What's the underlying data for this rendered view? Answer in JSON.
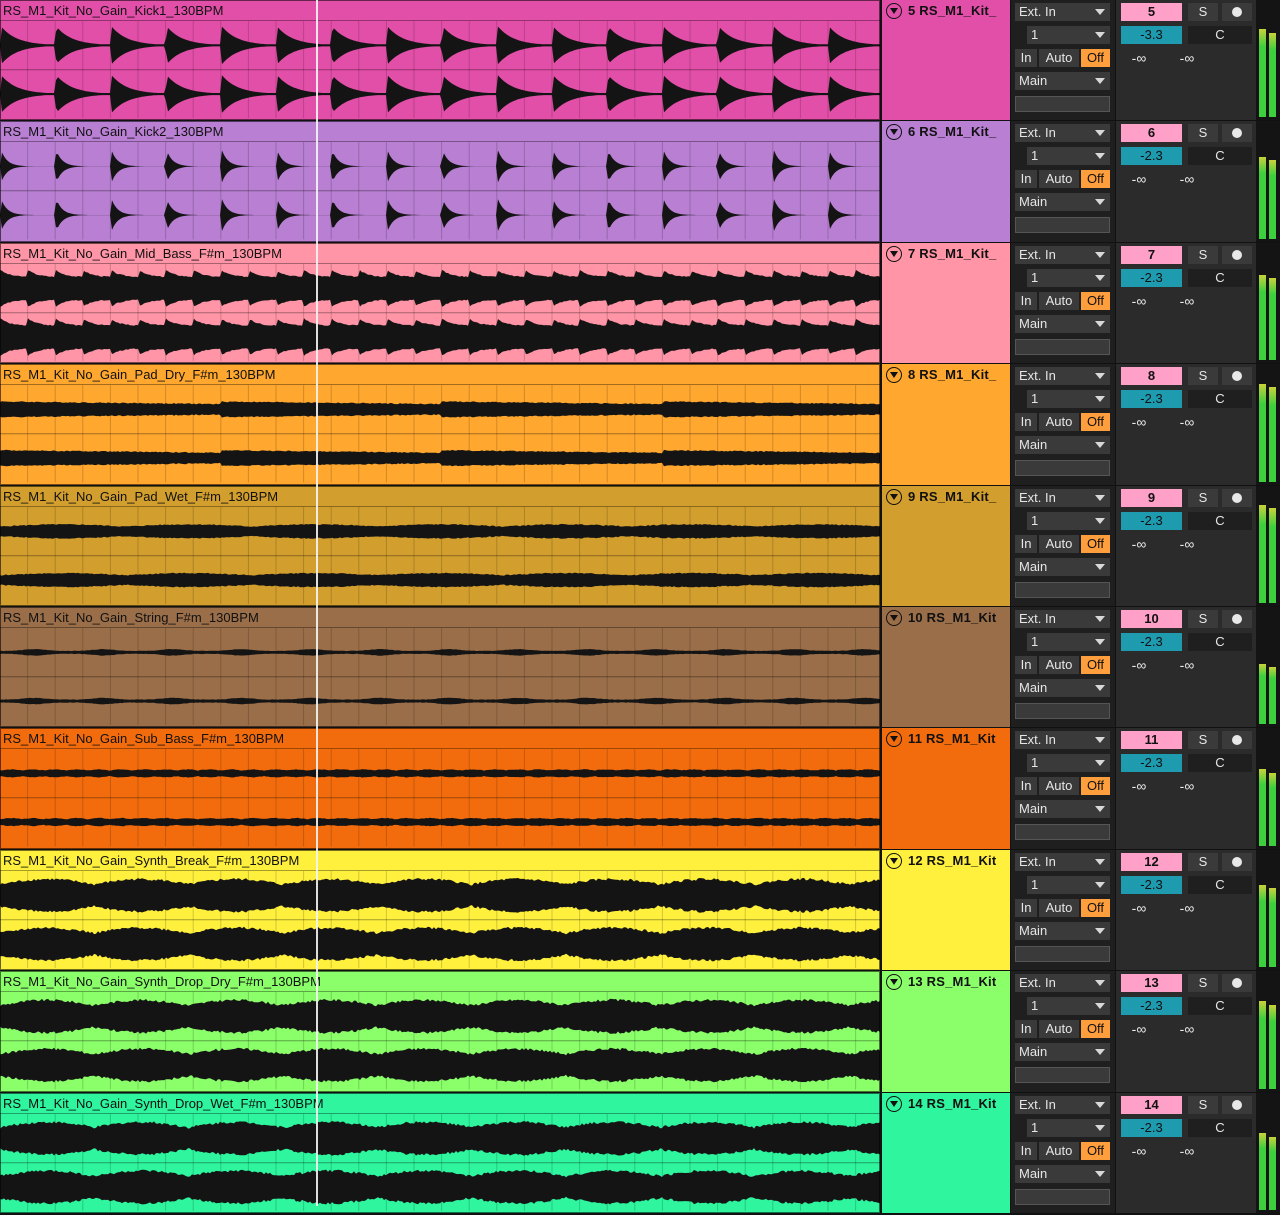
{
  "tracks": [
    {
      "clip_name": "RS_M1_Kit_No_Gain_Kick1_130BPM",
      "color": "#e24fa8",
      "header_color": "#e24fa8",
      "track_name": "5 RS_M1_Kit_",
      "number": "5",
      "volume": "-3.3",
      "pan": "C",
      "input_type": "Ext. In",
      "input_channel": "1",
      "monitor": [
        "In",
        "Auto",
        "Off"
      ],
      "output": "Main",
      "sends": [
        "-∞",
        "-∞"
      ],
      "solo": "S",
      "meter_level": 0.8,
      "wave": "kick"
    },
    {
      "clip_name": "RS_M1_Kit_No_Gain_Kick2_130BPM",
      "color": "#b87fd2",
      "header_color": "#b87fd2",
      "track_name": "6 RS_M1_Kit_",
      "number": "6",
      "volume": "-2.3",
      "pan": "C",
      "input_type": "Ext. In",
      "input_channel": "1",
      "monitor": [
        "In",
        "Auto",
        "Off"
      ],
      "output": "Main",
      "sends": [
        "-∞",
        "-∞"
      ],
      "solo": "S",
      "meter_level": 0.75,
      "wave": "kick2"
    },
    {
      "clip_name": "RS_M1_Kit_No_Gain_Mid_Bass_F#m_130BPM",
      "color": "#ff95a6",
      "header_color": "#ff95a6",
      "track_name": "7 RS_M1_Kit_",
      "number": "7",
      "volume": "-2.3",
      "pan": "C",
      "input_type": "Ext. In",
      "input_channel": "1",
      "monitor": [
        "In",
        "Auto",
        "Off"
      ],
      "output": "Main",
      "sends": [
        "-∞",
        "-∞"
      ],
      "solo": "S",
      "meter_level": 0.78,
      "wave": "bass"
    },
    {
      "clip_name": "RS_M1_Kit_No_Gain_Pad_Dry_F#m_130BPM",
      "color": "#ffa72e",
      "header_color": "#ffa72e",
      "track_name": "8 RS_M1_Kit_",
      "number": "8",
      "volume": "-2.3",
      "pan": "C",
      "input_type": "Ext. In",
      "input_channel": "1",
      "monitor": [
        "In",
        "Auto",
        "Off"
      ],
      "output": "Main",
      "sends": [
        "-∞",
        "-∞"
      ],
      "solo": "S",
      "meter_level": 0.9,
      "wave": "pad"
    },
    {
      "clip_name": "RS_M1_Kit_No_Gain_Pad_Wet_F#m_130BPM",
      "color": "#d29e2e",
      "header_color": "#d29e2e",
      "track_name": "9 RS_M1_Kit_",
      "number": "9",
      "volume": "-2.3",
      "pan": "C",
      "input_type": "Ext. In",
      "input_channel": "1",
      "monitor": [
        "In",
        "Auto",
        "Off"
      ],
      "output": "Main",
      "sends": [
        "-∞",
        "-∞"
      ],
      "solo": "S",
      "meter_level": 0.9,
      "wave": "padwet"
    },
    {
      "clip_name": "RS_M1_Kit_No_Gain_String_F#m_130BPM",
      "color": "#9a6e49",
      "header_color": "#9a6e49",
      "track_name": "10 RS_M1_Kit",
      "number": "10",
      "volume": "-2.3",
      "pan": "C",
      "input_type": "Ext. In",
      "input_channel": "1",
      "monitor": [
        "In",
        "Auto",
        "Off"
      ],
      "output": "Main",
      "sends": [
        "-∞",
        "-∞"
      ],
      "solo": "S",
      "meter_level": 0.55,
      "wave": "string"
    },
    {
      "clip_name": "RS_M1_Kit_No_Gain_Sub_Bass_F#m_130BPM",
      "color": "#f26c0d",
      "header_color": "#f26c0d",
      "track_name": "11 RS_M1_Kit",
      "number": "11",
      "volume": "-2.3",
      "pan": "C",
      "input_type": "Ext. In",
      "input_channel": "1",
      "monitor": [
        "In",
        "Auto",
        "Off"
      ],
      "output": "Main",
      "sends": [
        "-∞",
        "-∞"
      ],
      "solo": "S",
      "meter_level": 0.7,
      "wave": "sub"
    },
    {
      "clip_name": "RS_M1_Kit_No_Gain_Synth_Break_F#m_130BPM",
      "color": "#fff03d",
      "header_color": "#fff03d",
      "track_name": "12 RS_M1_Kit",
      "number": "12",
      "volume": "-2.3",
      "pan": "C",
      "input_type": "Ext. In",
      "input_channel": "1",
      "monitor": [
        "In",
        "Auto",
        "Off"
      ],
      "output": "Main",
      "sends": [
        "-∞",
        "-∞"
      ],
      "solo": "S",
      "meter_level": 0.75,
      "wave": "synth"
    },
    {
      "clip_name": "RS_M1_Kit_No_Gain_Synth_Drop_Dry_F#m_130BPM",
      "color": "#8aff6a",
      "header_color": "#8aff6a",
      "track_name": "13 RS_M1_Kit",
      "number": "13",
      "volume": "-2.3",
      "pan": "C",
      "input_type": "Ext. In",
      "input_channel": "1",
      "monitor": [
        "In",
        "Auto",
        "Off"
      ],
      "output": "Main",
      "sends": [
        "-∞",
        "-∞"
      ],
      "solo": "S",
      "meter_level": 0.8,
      "wave": "synth"
    },
    {
      "clip_name": "RS_M1_Kit_No_Gain_Synth_Drop_Wet_F#m_130BPM",
      "color": "#2ef59e",
      "header_color": "#2ef59e",
      "track_name": "14 RS_M1_Kit",
      "number": "14",
      "volume": "-2.3",
      "pan": "C",
      "input_type": "Ext. In",
      "input_channel": "1",
      "monitor": [
        "In",
        "Auto",
        "Off"
      ],
      "output": "Main",
      "sends": [
        "-∞",
        "-∞"
      ],
      "solo": "S",
      "meter_level": 0.7,
      "wave": "synth"
    }
  ],
  "colors": {
    "number_badge": "#ffa0c8",
    "volume_bg": "#1f9bb0",
    "monitor_off": "#ff9e3d",
    "meter": "#3ecf3e"
  },
  "icons": {
    "fold": "fold-triangle-icon",
    "arm": "record-arm-icon"
  }
}
